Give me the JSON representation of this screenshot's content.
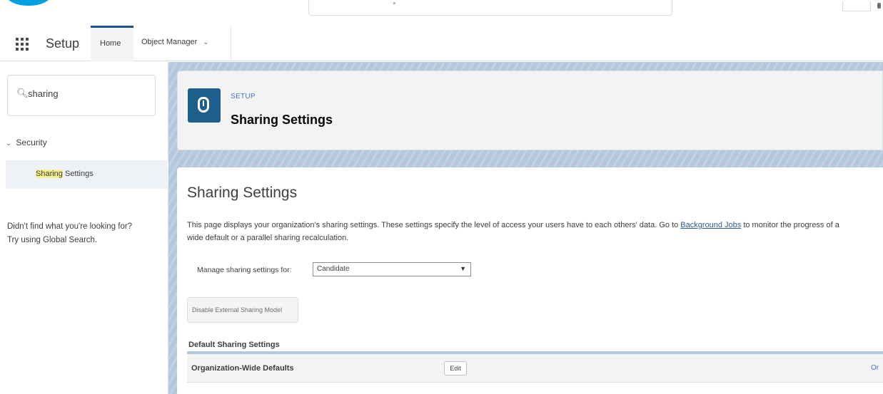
{
  "global_header": {
    "logo_icon": "salesforce-cloud-logo",
    "brand_color": "#00a1e0"
  },
  "context_bar": {
    "app_launcher_icon": "app-launcher-grid-icon",
    "app_name": "Setup",
    "tabs": [
      {
        "label": "Home",
        "active": true
      },
      {
        "label": "Object Manager",
        "has_dropdown": true
      }
    ],
    "dropdown_glyph": "⌄"
  },
  "sidebar": {
    "quick_find_icon": "search-icon",
    "quick_find_value": "sharing",
    "tree": {
      "section_label": "Security",
      "section_toggle": "⌄",
      "items": [
        {
          "label_match": "Sharing",
          "label_rest": " Settings",
          "selected": true
        }
      ]
    },
    "help_line_1": "Didn't find what you're looking for?",
    "help_line_2": "Try using Global Search."
  },
  "page_header": {
    "icon": "shield-icon",
    "eyebrow": "SETUP",
    "title": "Sharing Settings",
    "accent_color": "#1f5f8e"
  },
  "content": {
    "title": "Sharing Settings",
    "desc_part_1": "This page displays your organization's sharing settings. These settings specify the level of access your users have to each others' data. Go to ",
    "desc_link": "Background Jobs",
    "desc_part_2": " to monitor the progress of a",
    "desc_line_2": "wide default or a parallel sharing recalculation.",
    "manage_label": "Manage sharing settings for:",
    "manage_value": "Candidate",
    "select_arrow": "▼",
    "extended_button": "Disable External Sharing Model",
    "default_section_title": "Default Sharing Settings",
    "owd_label": "Organization-Wide Defaults",
    "edit_button": "Edit",
    "right_link_partial": "Or"
  }
}
